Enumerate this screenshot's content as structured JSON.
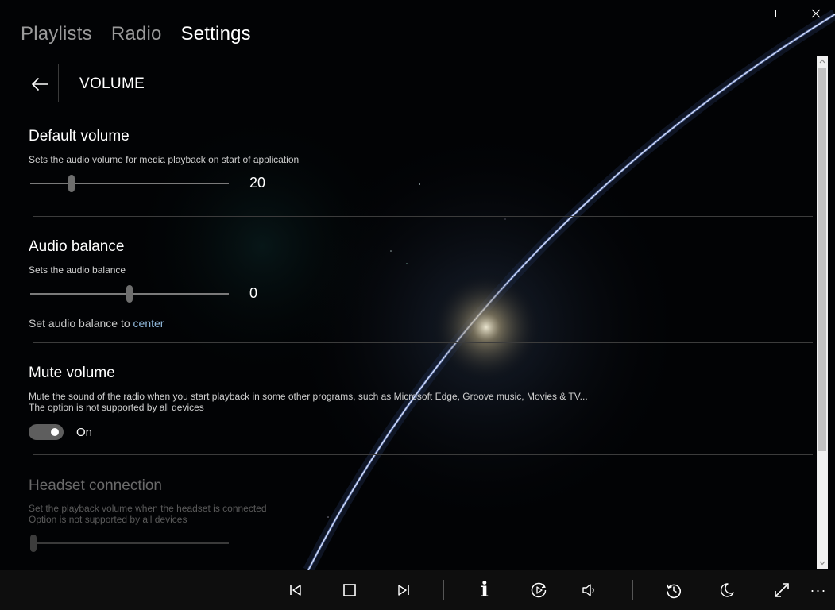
{
  "window": {
    "minimize_icon": "minimize-icon",
    "maximize_icon": "maximize-icon",
    "close_icon": "close-icon"
  },
  "nav": {
    "tabs": [
      {
        "label": "Playlists",
        "active": false
      },
      {
        "label": "Radio",
        "active": false
      },
      {
        "label": "Settings",
        "active": true
      }
    ]
  },
  "header": {
    "back_icon": "arrow-left-icon",
    "title": "VOLUME"
  },
  "sections": {
    "default_volume": {
      "title": "Default volume",
      "description": "Sets the audio volume for media playback on start of application",
      "value": "20",
      "slider_fraction": 0.2
    },
    "audio_balance": {
      "title": "Audio balance",
      "description": "Sets the audio balance",
      "value": "0",
      "slider_fraction": 0.5,
      "reset_prefix": "Set audio balance to ",
      "reset_link": "center"
    },
    "mute_volume": {
      "title": "Mute volume",
      "description_line1": "Mute the sound of the radio when you start playback in some other programs, such as Microsoft Edge, Groove music, Movies & TV...",
      "description_line2": "The option is not supported by all devices",
      "toggle_state": "On",
      "toggle_on": true
    },
    "headset_connection": {
      "title": "Headset connection",
      "description_line1": "Set the playback volume when the headset is connected",
      "description_line2": "Option is not supported by all devices",
      "enabled": false,
      "slider_fraction": 0.0
    }
  },
  "bottom_bar": {
    "buttons": [
      {
        "name": "previous-icon"
      },
      {
        "name": "stop-icon"
      },
      {
        "name": "next-icon"
      },
      {
        "name": "info-icon",
        "glyph": "i"
      },
      {
        "name": "play-circle-icon"
      },
      {
        "name": "volume-icon"
      },
      {
        "name": "history-icon"
      },
      {
        "name": "sleep-timer-moon-icon"
      },
      {
        "name": "fullscreen-icon"
      },
      {
        "name": "more-icon",
        "glyph": "···"
      }
    ]
  },
  "colors": {
    "accent_link": "#8fb7d9",
    "background": "#000000",
    "bottom_bar": "#0e0e0e"
  }
}
